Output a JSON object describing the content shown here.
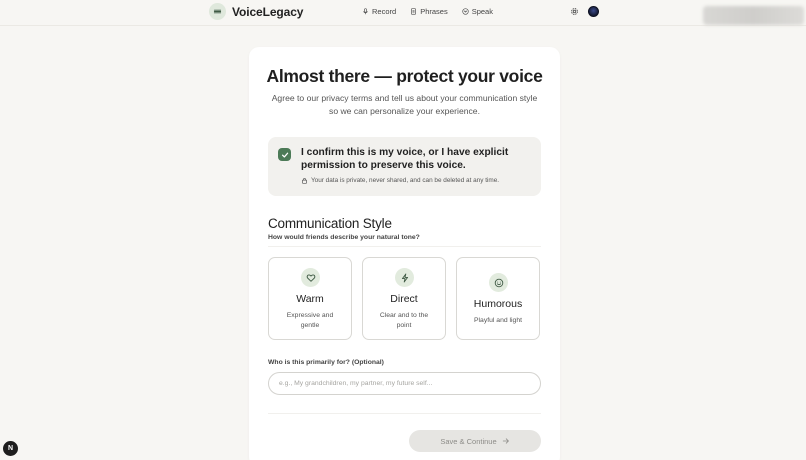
{
  "app": {
    "name": "VoiceLegacy",
    "logo_icon": "audio-lines-icon",
    "accent_color": "#4c7a57"
  },
  "nav": {
    "items": [
      {
        "label": "Record",
        "icon": "microphone-icon"
      },
      {
        "label": "Phrases",
        "icon": "document-icon"
      },
      {
        "label": "Speak",
        "icon": "speech-wave-icon"
      }
    ],
    "settings_icon": "gear-icon",
    "avatar_icon": "avatar"
  },
  "page": {
    "title": "Almost there — protect your voice",
    "subtitle": "Agree to our privacy terms and tell us about your communication style so we can personalize your experience."
  },
  "consent": {
    "checked": true,
    "text": "I confirm this is my voice, or I have explicit permission to preserve this voice.",
    "note": "Your data is private, never shared, and can be deleted at any time."
  },
  "communication_style": {
    "title": "Communication Style",
    "subtitle": "How would friends describe your natural tone?",
    "options": [
      {
        "label": "Warm",
        "description": "Expressive and gentle",
        "icon": "heart-icon"
      },
      {
        "label": "Direct",
        "description": "Clear and to the point",
        "icon": "lightning-icon"
      },
      {
        "label": "Humorous",
        "description": "Playful and light",
        "icon": "smile-icon"
      }
    ]
  },
  "audience": {
    "label": "Who is this primarily for? (Optional)",
    "placeholder": "e.g., My grandchildren, my partner, my future self...",
    "value": ""
  },
  "actions": {
    "save_label": "Save & Continue",
    "save_enabled": false
  },
  "corner_badge": "N"
}
